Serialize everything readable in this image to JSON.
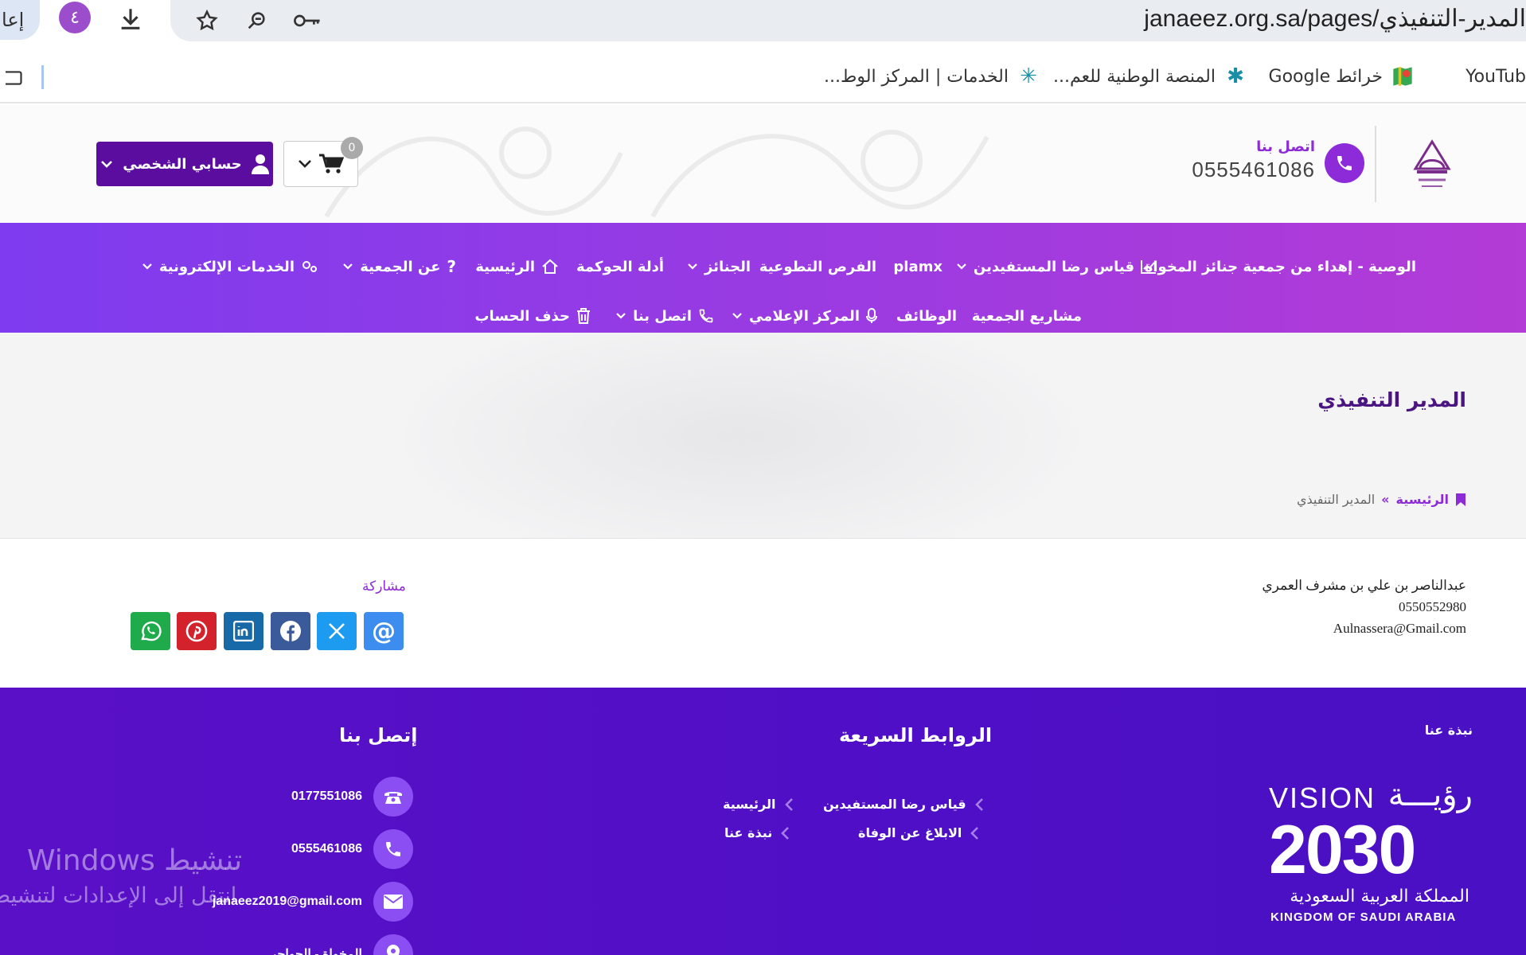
{
  "browser": {
    "tab_partial": "إعا",
    "extension_badge": "٤",
    "url": "janaeez.org.sa/pages/المدير-التنفيذي",
    "bookmarks": [
      {
        "label": "YouTub"
      },
      {
        "label": "خرائط Google"
      },
      {
        "label": "المنصة الوطنية للعم..."
      },
      {
        "label": "الخدمات | المركز الوط..."
      }
    ]
  },
  "header": {
    "contact_label": "اتصل بنا",
    "contact_phone": "0555461086",
    "cart_count": "0",
    "account_label": "حسابي الشخصي"
  },
  "nav": {
    "row1": [
      {
        "label": "الوصية - إهداء من جمعية جنائز المخواة",
        "dropdown": false
      },
      {
        "label": "قياس رضا المستفيدين",
        "dropdown": true
      },
      {
        "label": "plamx",
        "dropdown": false
      },
      {
        "label": "الفرص التطوعية",
        "dropdown": false
      },
      {
        "label": "الجنائز",
        "dropdown": true
      },
      {
        "label": "أدلة الحوكمة",
        "dropdown": false
      },
      {
        "label": "الرئيسية",
        "dropdown": false
      },
      {
        "label": "عن الجمعية",
        "dropdown": true
      },
      {
        "label": "الخدمات الإلكترونية",
        "dropdown": true
      }
    ],
    "row2": [
      {
        "label": "مشاريع الجمعية",
        "dropdown": false
      },
      {
        "label": "الوظائف",
        "dropdown": false
      },
      {
        "label": "المركز الإعلامي",
        "dropdown": true
      },
      {
        "label": "اتصل بنا",
        "dropdown": true
      },
      {
        "label": "حذف الحساب",
        "dropdown": false
      }
    ]
  },
  "page": {
    "title": "المدير التنفيذي",
    "breadcrumb_home": "الرئيسية",
    "breadcrumb_sep": "»",
    "breadcrumb_current": "المدير التنفيذي"
  },
  "content": {
    "name": "عبدالناصر بن علي بن مشرف العمري",
    "phone": "0550552980",
    "email": "Aulnassera@Gmail.com",
    "share_label": "مشاركة"
  },
  "colors": {
    "whatsapp": "#1faa4b",
    "pinterest": "#d3222c",
    "linkedin": "#1769a8",
    "facebook": "#3b5a9a",
    "x": "#1d9bf0",
    "email": "#3d8cf0"
  },
  "footer": {
    "about_title": "نبذة عنا",
    "quick_links_title": "الروابط السريعة",
    "contact_title": "إتصل بنا",
    "quick_links": [
      "قياس رضا المستفيدين",
      "الرئيسية",
      "الابلاغ عن الوفاة",
      "نبذة عنا"
    ],
    "contacts": [
      {
        "icon": "landline-icon",
        "value": "0177551086"
      },
      {
        "icon": "phone-icon",
        "value": "0555461086"
      },
      {
        "icon": "mail-icon",
        "value": "janaeez2019@gmail.com"
      },
      {
        "icon": "location-icon",
        "value": "المخواة - الحواجر"
      }
    ],
    "vision": {
      "en_top": "VISION",
      "ar_top": "رؤيـــة",
      "year": "2030",
      "ar_bottom": "المملكة العربية السعودية",
      "en_bottom": "KINGDOM OF SAUDI ARABIA"
    }
  },
  "overlay": {
    "windows_line1": "تنشيط Windows",
    "windows_line2": "انتقل إلى الإعدادات لتنشيط"
  }
}
